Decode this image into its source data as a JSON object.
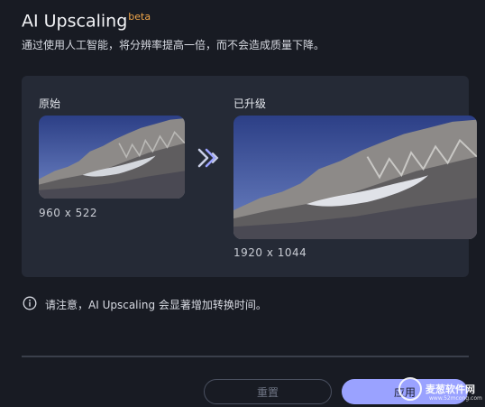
{
  "header": {
    "title": "AI Upscaling",
    "badge": "beta",
    "description": "通过使用人工智能，将分辨率提高一倍，而不会造成质量下降。"
  },
  "comparison": {
    "original": {
      "label": "原始",
      "resolution": "960 x 522"
    },
    "upscaled": {
      "label": "已升级",
      "resolution": "1920 x 1044"
    },
    "arrow_icon": "double-chevron-right-icon"
  },
  "notice": {
    "icon": "info-icon",
    "text": "请注意，AI Upscaling 会显著增加转换时间。"
  },
  "buttons": {
    "reset_label": "重置",
    "apply_label": "应用"
  },
  "watermark": {
    "text": "麦葱软件网",
    "url": "www.52mcong.com"
  },
  "colors": {
    "background": "#181b23",
    "panel": "#252a36",
    "accent": "#9aa2ff",
    "beta": "#f0a64a"
  }
}
